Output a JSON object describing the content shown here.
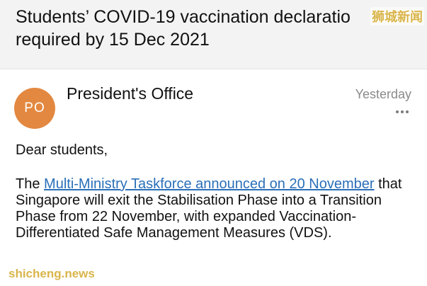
{
  "email": {
    "subject_line1": "Students’ COVID-19 vaccination declaratio",
    "subject_line2": "required by 15 Dec 2021",
    "sender": {
      "initials": "PO",
      "name": "President's Office",
      "avatar_color": "#e38840"
    },
    "date": "Yesterday",
    "more_icon": "more-horizontal-icon",
    "body": {
      "greeting": "Dear students,",
      "para_prefix": "The ",
      "link_text": "Multi-Ministry Taskforce announced on 20 November",
      "para_rest": " that Singapore will exit the Stabilisation Phase into a Transition Phase from 22 November, with expanded Vaccination-Differentiated Safe Management Measures (VDS)."
    },
    "link_color": "#2a6fb8"
  },
  "watermarks": {
    "top": "狮城新闻",
    "bottom": "shicheng.news"
  }
}
